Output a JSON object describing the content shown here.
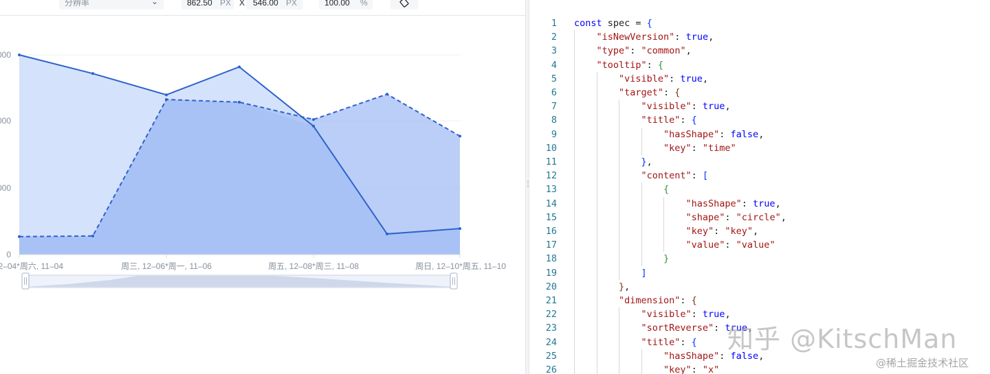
{
  "toolbar": {
    "resolution_placeholder": "分辨率",
    "width_value": "862.50",
    "width_unit": "PX",
    "times": "X",
    "height_value": "546.00",
    "height_unit": "PX",
    "zoom_value": "100.00",
    "zoom_unit": "%",
    "rotate_icon": "rotate-icon"
  },
  "chart_data": {
    "type": "area",
    "y_tick_labels": [
      "000",
      "000",
      "000",
      "0"
    ],
    "x_tick_labels": [
      "2–04*周六, 11–04",
      "周三, 12–06*周一, 11–06",
      "周五, 12–08*周三, 11–08",
      "周日, 12–10*周五, 11–10"
    ],
    "series": [
      {
        "style": "solid",
        "values": [
          300,
          272,
          240,
          282,
          193,
          31,
          39
        ]
      },
      {
        "style": "dashed",
        "values": [
          27,
          28,
          233,
          229,
          203,
          241,
          178
        ]
      }
    ],
    "ylim": [
      0,
      300
    ],
    "colors": {
      "line": "#2d62cc",
      "area_light": "#d3e0fb",
      "area_dark": "#a9c2f5"
    },
    "scrollbar": {
      "range": [
        0,
        1
      ]
    }
  },
  "editor": {
    "lines": [
      {
        "n": "1",
        "i": 0,
        "t": [
          [
            "k",
            "const"
          ],
          [
            "p",
            " spec = "
          ],
          [
            "b1",
            "{"
          ]
        ]
      },
      {
        "n": "2",
        "i": 1,
        "t": [
          [
            "s",
            "\"isNewVersion\""
          ],
          [
            "p",
            ": "
          ],
          [
            "k",
            "true"
          ],
          [
            "p",
            ","
          ]
        ]
      },
      {
        "n": "3",
        "i": 1,
        "t": [
          [
            "s",
            "\"type\""
          ],
          [
            "p",
            ": "
          ],
          [
            "s",
            "\"common\""
          ],
          [
            "p",
            ","
          ]
        ]
      },
      {
        "n": "4",
        "i": 1,
        "t": [
          [
            "s",
            "\"tooltip\""
          ],
          [
            "p",
            ": "
          ],
          [
            "b2",
            "{"
          ]
        ]
      },
      {
        "n": "5",
        "i": 2,
        "t": [
          [
            "s",
            "\"visible\""
          ],
          [
            "p",
            ": "
          ],
          [
            "k",
            "true"
          ],
          [
            "p",
            ","
          ]
        ]
      },
      {
        "n": "6",
        "i": 2,
        "t": [
          [
            "s",
            "\"target\""
          ],
          [
            "p",
            ": "
          ],
          [
            "b3",
            "{"
          ]
        ]
      },
      {
        "n": "7",
        "i": 3,
        "t": [
          [
            "s",
            "\"visible\""
          ],
          [
            "p",
            ": "
          ],
          [
            "k",
            "true"
          ],
          [
            "p",
            ","
          ]
        ]
      },
      {
        "n": "8",
        "i": 3,
        "t": [
          [
            "s",
            "\"title\""
          ],
          [
            "p",
            ": "
          ],
          [
            "b1",
            "{"
          ]
        ]
      },
      {
        "n": "9",
        "i": 4,
        "t": [
          [
            "s",
            "\"hasShape\""
          ],
          [
            "p",
            ": "
          ],
          [
            "k",
            "false"
          ],
          [
            "p",
            ","
          ]
        ]
      },
      {
        "n": "10",
        "i": 4,
        "t": [
          [
            "s",
            "\"key\""
          ],
          [
            "p",
            ": "
          ],
          [
            "s",
            "\"time\""
          ]
        ]
      },
      {
        "n": "11",
        "i": 3,
        "t": [
          [
            "b1",
            "}"
          ],
          [
            "p",
            ","
          ]
        ]
      },
      {
        "n": "12",
        "i": 3,
        "t": [
          [
            "s",
            "\"content\""
          ],
          [
            "p",
            ": "
          ],
          [
            "b1",
            "["
          ]
        ]
      },
      {
        "n": "13",
        "i": 4,
        "t": [
          [
            "b2",
            "{"
          ]
        ]
      },
      {
        "n": "14",
        "i": 5,
        "t": [
          [
            "s",
            "\"hasShape\""
          ],
          [
            "p",
            ": "
          ],
          [
            "k",
            "true"
          ],
          [
            "p",
            ","
          ]
        ]
      },
      {
        "n": "15",
        "i": 5,
        "t": [
          [
            "s",
            "\"shape\""
          ],
          [
            "p",
            ": "
          ],
          [
            "s",
            "\"circle\""
          ],
          [
            "p",
            ","
          ]
        ]
      },
      {
        "n": "16",
        "i": 5,
        "t": [
          [
            "s",
            "\"key\""
          ],
          [
            "p",
            ": "
          ],
          [
            "s",
            "\"key\""
          ],
          [
            "p",
            ","
          ]
        ]
      },
      {
        "n": "17",
        "i": 5,
        "t": [
          [
            "s",
            "\"value\""
          ],
          [
            "p",
            ": "
          ],
          [
            "s",
            "\"value\""
          ]
        ]
      },
      {
        "n": "18",
        "i": 4,
        "t": [
          [
            "b2",
            "}"
          ]
        ]
      },
      {
        "n": "19",
        "i": 3,
        "t": [
          [
            "b1",
            "]"
          ]
        ]
      },
      {
        "n": "20",
        "i": 2,
        "t": [
          [
            "b3",
            "}"
          ],
          [
            "p",
            ","
          ]
        ]
      },
      {
        "n": "21",
        "i": 2,
        "t": [
          [
            "s",
            "\"dimension\""
          ],
          [
            "p",
            ": "
          ],
          [
            "b3",
            "{"
          ]
        ]
      },
      {
        "n": "22",
        "i": 3,
        "t": [
          [
            "s",
            "\"visible\""
          ],
          [
            "p",
            ": "
          ],
          [
            "k",
            "true"
          ],
          [
            "p",
            ","
          ]
        ]
      },
      {
        "n": "23",
        "i": 3,
        "t": [
          [
            "s",
            "\"sortReverse\""
          ],
          [
            "p",
            ": "
          ],
          [
            "k",
            "true"
          ],
          [
            "p",
            ","
          ]
        ]
      },
      {
        "n": "24",
        "i": 3,
        "t": [
          [
            "s",
            "\"title\""
          ],
          [
            "p",
            ": "
          ],
          [
            "b1",
            "{"
          ]
        ]
      },
      {
        "n": "25",
        "i": 4,
        "t": [
          [
            "s",
            "\"hasShape\""
          ],
          [
            "p",
            ": "
          ],
          [
            "k",
            "false"
          ],
          [
            "p",
            ","
          ]
        ]
      },
      {
        "n": "26",
        "i": 4,
        "t": [
          [
            "s",
            "\"key\""
          ],
          [
            "p",
            ": "
          ],
          [
            "s",
            "\"x\""
          ]
        ]
      }
    ]
  },
  "watermark": {
    "main": "知乎 @KitschMan",
    "sub": "@稀土掘金技术社区"
  }
}
